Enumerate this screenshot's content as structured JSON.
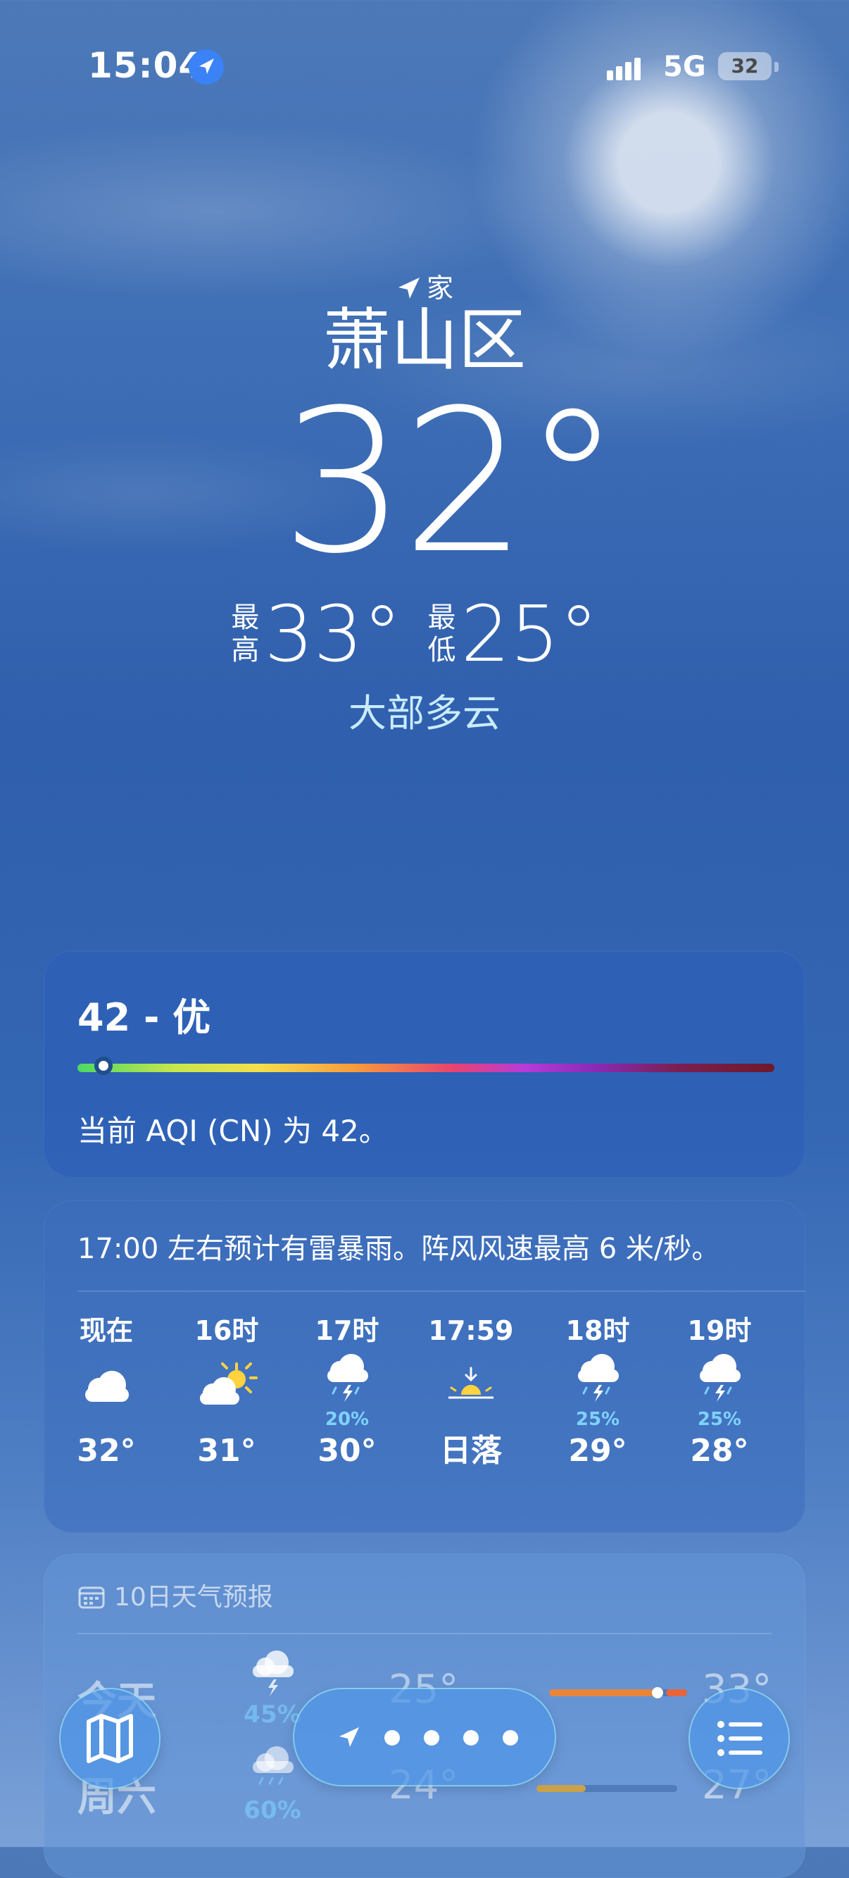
{
  "status_bar": {
    "time": "15:04",
    "network": "5G",
    "battery": "32"
  },
  "location": {
    "tag": "家",
    "city": "萧山区"
  },
  "current": {
    "temperature": "32°",
    "high_label": "最高",
    "high": "33°",
    "low_label": "最低",
    "low": "25°",
    "condition": "大部多云"
  },
  "aqi": {
    "title": "42 - 优",
    "value": 42,
    "description": "当前 AQI (CN) 为 42。"
  },
  "hourly": {
    "summary": "17:00 左右预计有雷暴雨。阵风风速最高 6 米/秒。",
    "items": [
      {
        "label": "现在",
        "icon": "cloud-icon",
        "precip": "",
        "temp": "32°"
      },
      {
        "label": "16时",
        "icon": "partly-sunny-icon",
        "precip": "",
        "temp": "31°"
      },
      {
        "label": "17时",
        "icon": "thunderstorm-icon",
        "precip": "20%",
        "temp": "30°"
      },
      {
        "label": "17:59",
        "icon": "sunset-icon",
        "precip": "",
        "temp": "日落"
      },
      {
        "label": "18时",
        "icon": "thunderstorm-icon",
        "precip": "25%",
        "temp": "29°"
      },
      {
        "label": "19时",
        "icon": "thunderstorm-icon",
        "precip": "25%",
        "temp": "28°"
      }
    ]
  },
  "forecast": {
    "title": "10日天气预报",
    "days": [
      {
        "day": "今天",
        "icon": "thunderstorm-icon",
        "precip": "45%",
        "low": "25°",
        "high": "33°"
      },
      {
        "day": "周六",
        "icon": "rain-icon",
        "precip": "60%",
        "low": "24°",
        "high": "27°"
      }
    ]
  },
  "colors": {
    "accent": "#3b82f6",
    "precip": "#7fd2ff",
    "condition": "#c9ecff"
  }
}
